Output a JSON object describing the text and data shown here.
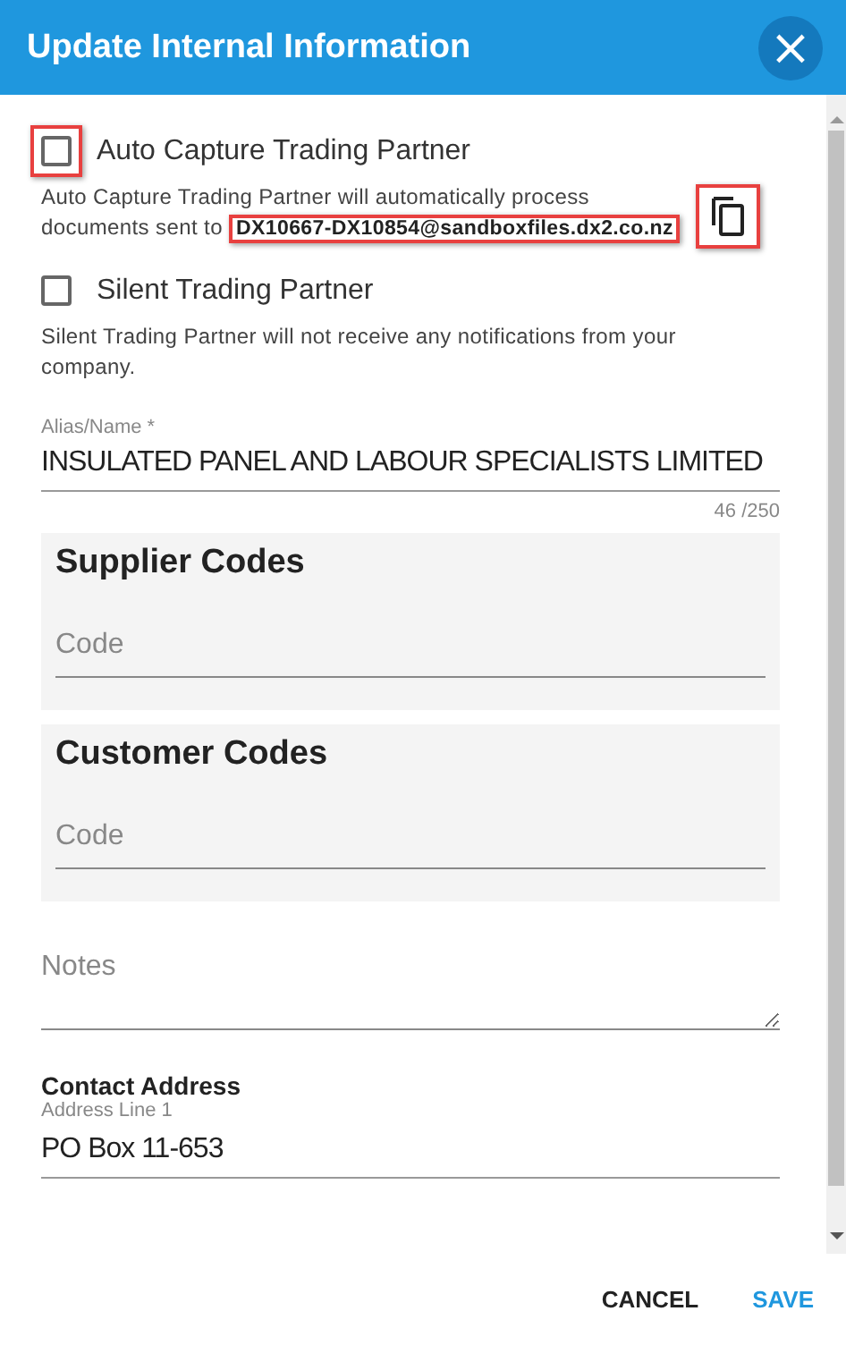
{
  "dialog": {
    "title": "Update Internal Information",
    "close_icon": "×"
  },
  "options": [
    {
      "label": "Auto Capture Trading Partner",
      "checked": false,
      "highlighted": true,
      "description": "Auto Capture Trading Partner will automatically process documents sent to ",
      "email": "DX10667-DX10854@sandboxfiles.dx2.co.nz",
      "email_highlighted": true,
      "copy_highlighted": true
    },
    {
      "label": "Silent Trading Partner",
      "checked": false,
      "highlighted": false,
      "description": "Silent Trading Partner will not receive any notifications from your company."
    }
  ],
  "alias": {
    "label": "Alias/Name *",
    "value": "INSULATED PANEL AND LABOUR SPECIALISTS LIMITED",
    "counter": "46 /250"
  },
  "code_sections": [
    {
      "title": "Supplier Codes",
      "placeholder": "Code"
    },
    {
      "title": "Customer Codes",
      "placeholder": "Code"
    }
  ],
  "notes": {
    "placeholder": "Notes"
  },
  "contact_address": {
    "title": "Contact Address",
    "line1_label": "Address Line 1",
    "line1_value": "PO Box 11-653"
  },
  "buttons": [
    {
      "label": "CANCEL",
      "kind": "plain"
    },
    {
      "label": "SAVE",
      "kind": "primary"
    }
  ]
}
